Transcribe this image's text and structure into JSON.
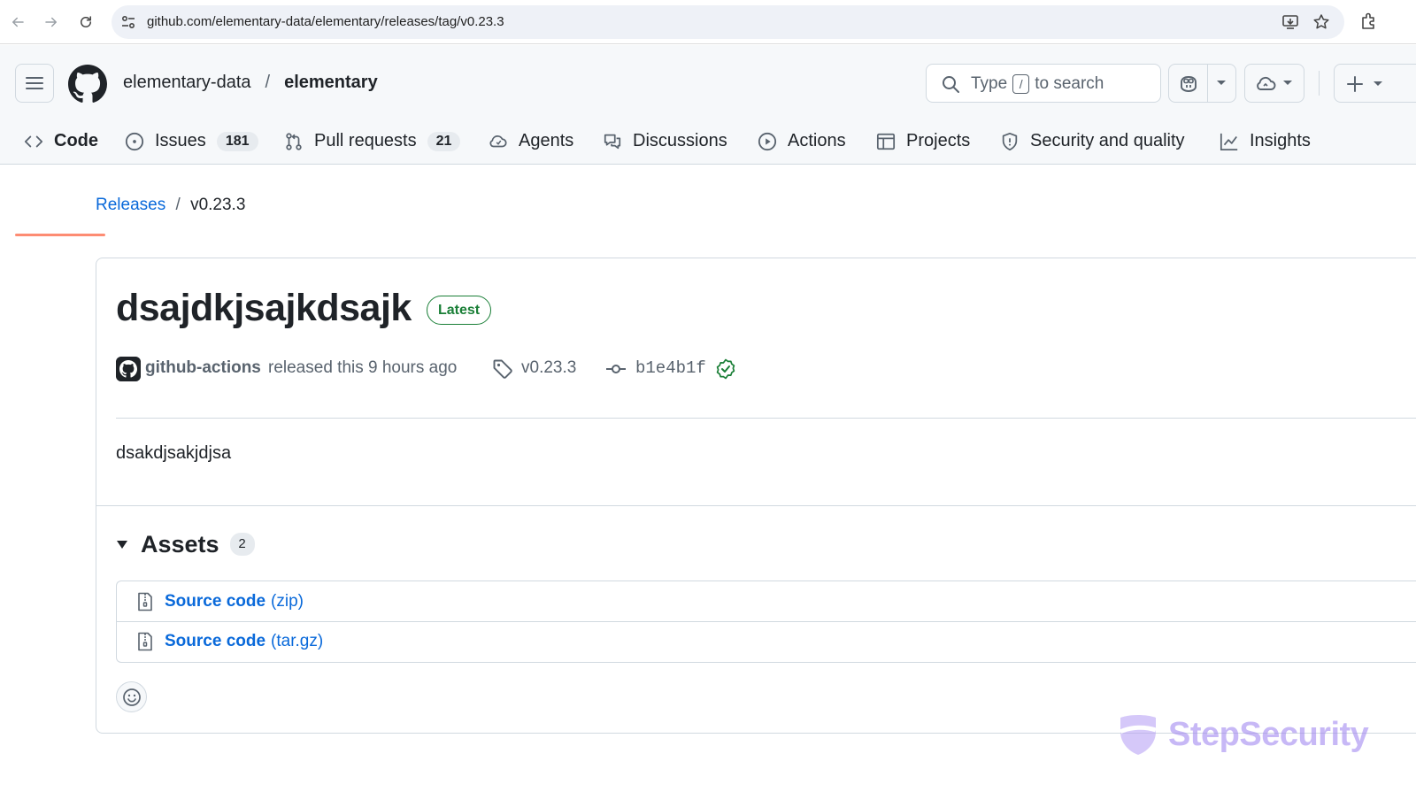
{
  "browser": {
    "url": "github.com/elementary-data/elementary/releases/tag/v0.23.3"
  },
  "header": {
    "owner": "elementary-data",
    "separator": "/",
    "repo": "elementary",
    "search": {
      "prefix": "Type",
      "key": "/",
      "suffix": "to search"
    }
  },
  "tabs": [
    {
      "label": "Code",
      "icon": "code-icon",
      "active": true
    },
    {
      "label": "Issues",
      "icon": "issue-opened-icon",
      "count": "181"
    },
    {
      "label": "Pull requests",
      "icon": "git-pull-request-icon",
      "count": "21"
    },
    {
      "label": "Agents",
      "icon": "agent-icon"
    },
    {
      "label": "Discussions",
      "icon": "comment-discussion-icon"
    },
    {
      "label": "Actions",
      "icon": "play-icon"
    },
    {
      "label": "Projects",
      "icon": "table-icon"
    },
    {
      "label": "Security and quality",
      "icon": "shield-icon"
    },
    {
      "label": "Insights",
      "icon": "graph-icon"
    }
  ],
  "breadcrumb": {
    "link": "Releases",
    "separator": "/",
    "current": "v0.23.3"
  },
  "release": {
    "title": "dsajdkjsajkdsajk",
    "badge": "Latest",
    "author": "github-actions",
    "released_text": "released this 9 hours ago",
    "tag": "v0.23.3",
    "commit": "b1e4b1f",
    "notes": "dsakdjsakjdjsa",
    "colors": {
      "accent_green": "#1a7f37",
      "link_blue": "#0969da"
    }
  },
  "assets": {
    "title": "Assets",
    "count": "2",
    "items": [
      {
        "main": "Source code",
        "ext": "(zip)"
      },
      {
        "main": "Source code",
        "ext": "(tar.gz)"
      }
    ]
  },
  "watermark": {
    "text": "StepSecurity"
  }
}
